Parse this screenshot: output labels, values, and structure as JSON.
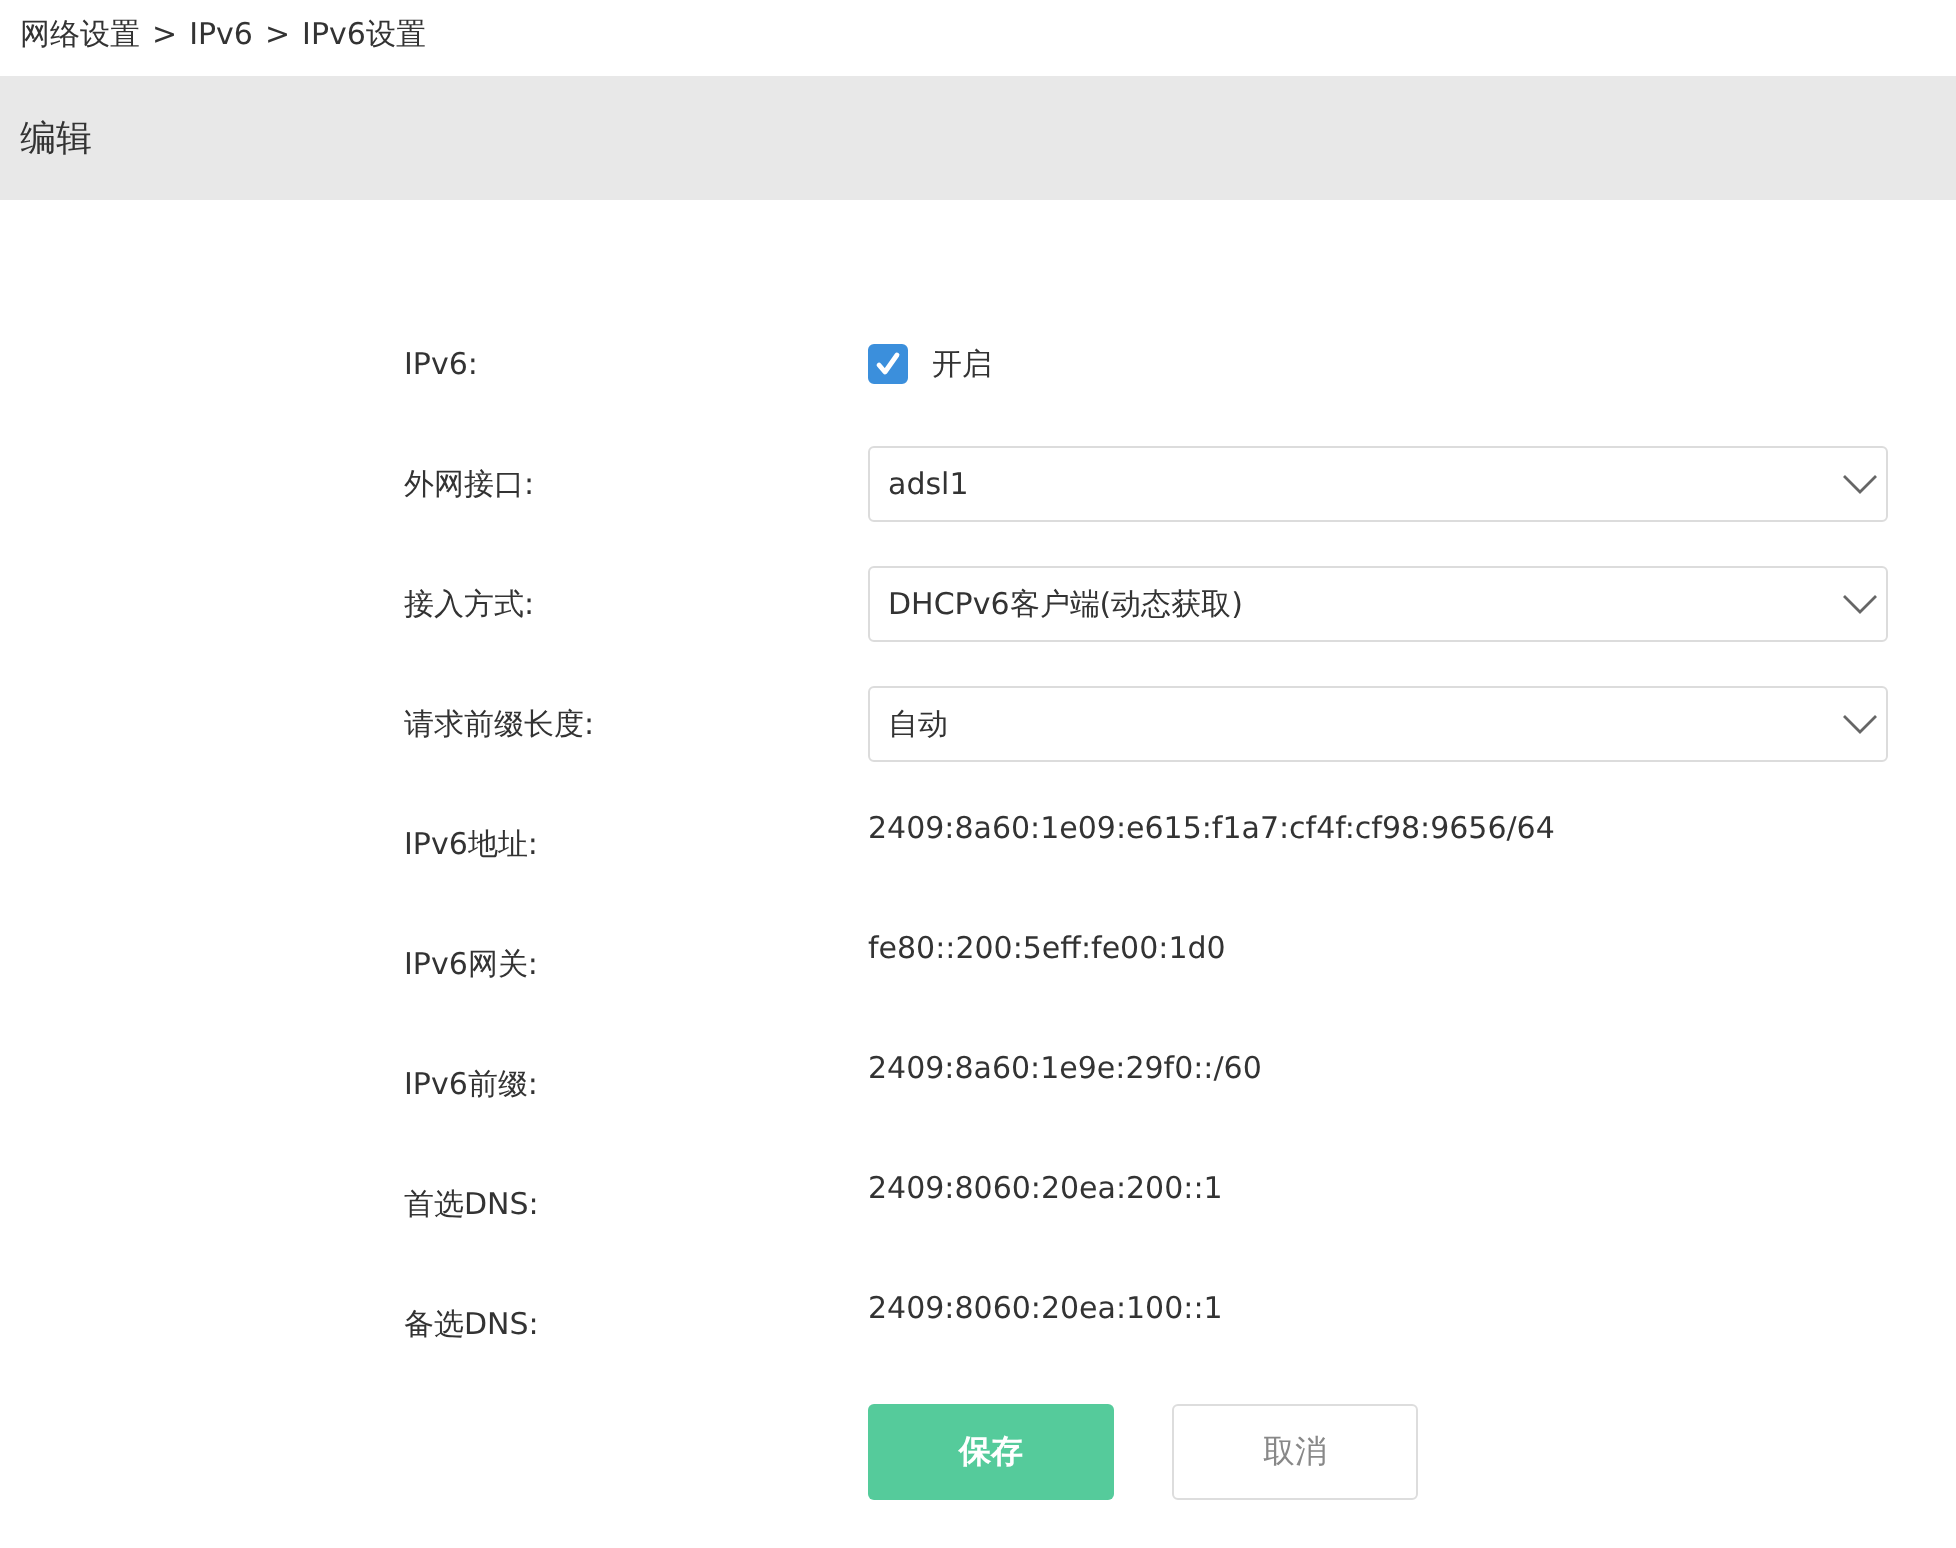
{
  "breadcrumb": {
    "separator": ">",
    "items": [
      "网络设置",
      "IPv6",
      "IPv6设置"
    ]
  },
  "header": {
    "title": "编辑"
  },
  "fields": [
    {
      "kind": "checkbox",
      "label": "IPv6:",
      "checked": true,
      "text": "开启"
    },
    {
      "kind": "select",
      "label": "外网接口:",
      "value": "adsl1"
    },
    {
      "kind": "select",
      "label": "接入方式:",
      "value": "DHCPv6客户端(动态获取)"
    },
    {
      "kind": "select",
      "label": "请求前缀长度:",
      "value": "自动"
    },
    {
      "kind": "text",
      "label": "IPv6地址:",
      "value": "2409:8a60:1e09:e615:f1a7:cf4f:cf98:9656/64"
    },
    {
      "kind": "text",
      "label": "IPv6网关:",
      "value": "fe80::200:5eff:fe00:1d0"
    },
    {
      "kind": "text",
      "label": "IPv6前缀:",
      "value": "2409:8a60:1e9e:29f0::/60"
    },
    {
      "kind": "text",
      "label": "首选DNS:",
      "value": "2409:8060:20ea:200::1"
    },
    {
      "kind": "text",
      "label": "备选DNS:",
      "value": "2409:8060:20ea:100::1"
    }
  ],
  "buttons": [
    {
      "kind": "primary",
      "label": "保存"
    },
    {
      "kind": "secondary",
      "label": "取消"
    }
  ]
}
